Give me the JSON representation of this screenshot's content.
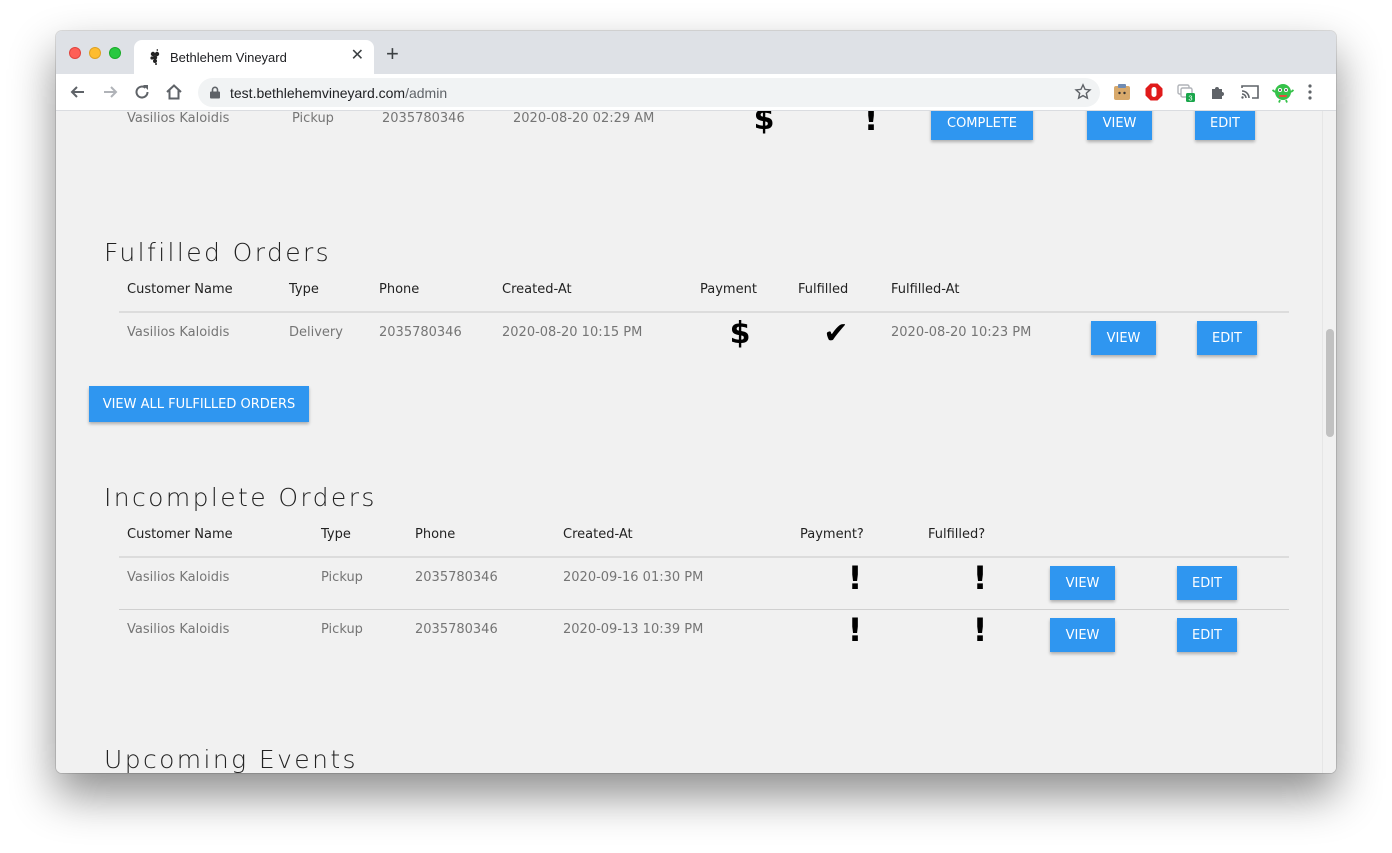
{
  "browser": {
    "tab_title": "Bethlehem Vineyard",
    "url_domain": "test.bethlehemvineyard.com",
    "url_path": "/admin",
    "extension_badge": "3"
  },
  "top_row": {
    "customer": "Vasilios Kaloidis",
    "type": "Pickup",
    "phone": "2035780346",
    "created": "2020-08-20 02:29 AM",
    "payment_icon": "dollar-icon",
    "fulfilled_icon": "exclamation-icon",
    "complete_label": "COMPLETE",
    "view_label": "VIEW",
    "edit_label": "EDIT"
  },
  "fulfilled": {
    "heading": "Fulfilled Orders",
    "headers": {
      "customer": "Customer Name",
      "type": "Type",
      "phone": "Phone",
      "created": "Created-At",
      "payment": "Payment",
      "fulfilled": "Fulfilled",
      "fulfilled_at": "Fulfilled-At"
    },
    "rows": [
      {
        "customer": "Vasilios Kaloidis",
        "type": "Delivery",
        "phone": "2035780346",
        "created": "2020-08-20 10:15 PM",
        "payment_icon": "dollar-icon",
        "fulfilled_icon": "check-icon",
        "fulfilled_at": "2020-08-20 10:23 PM",
        "view_label": "VIEW",
        "edit_label": "EDIT"
      }
    ],
    "view_all_label": "VIEW ALL FULFILLED ORDERS"
  },
  "incomplete": {
    "heading": "Incomplete Orders",
    "headers": {
      "customer": "Customer Name",
      "type": "Type",
      "phone": "Phone",
      "created": "Created-At",
      "payment": "Payment?",
      "fulfilled": "Fulfilled?"
    },
    "rows": [
      {
        "customer": "Vasilios Kaloidis",
        "type": "Pickup",
        "phone": "2035780346",
        "created": "2020-09-16 01:30 PM",
        "payment_icon": "exclamation-icon",
        "fulfilled_icon": "exclamation-icon",
        "view_label": "VIEW",
        "edit_label": "EDIT"
      },
      {
        "customer": "Vasilios Kaloidis",
        "type": "Pickup",
        "phone": "2035780346",
        "created": "2020-09-13 10:39 PM",
        "payment_icon": "exclamation-icon",
        "fulfilled_icon": "exclamation-icon",
        "view_label": "VIEW",
        "edit_label": "EDIT"
      }
    ]
  },
  "events": {
    "heading": "Upcoming Events"
  },
  "colors": {
    "button": "#2f96f0",
    "page_bg": "#f1f1f1"
  }
}
